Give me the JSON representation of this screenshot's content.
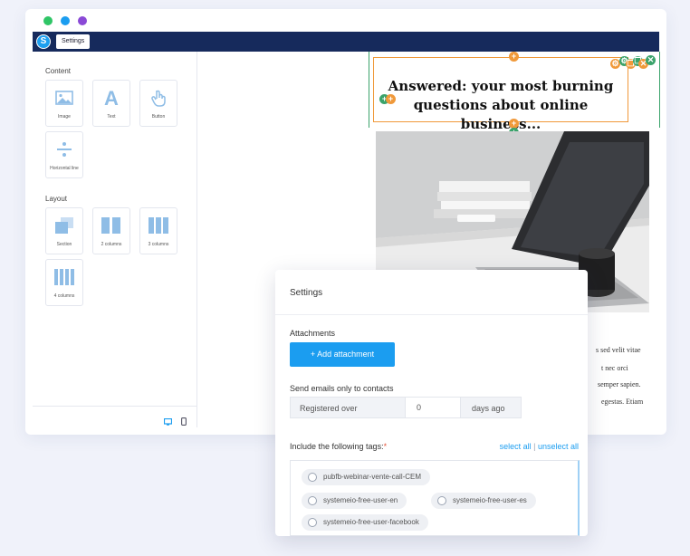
{
  "window": {
    "dot_colors": [
      "#2fc566",
      "#1b9df0",
      "#8a49d6"
    ]
  },
  "topbar": {
    "logo_letter": "S",
    "settings_label": "Settings"
  },
  "sidebar": {
    "content_title": "Content",
    "content_items": [
      {
        "label": "Image",
        "icon": "image-icon"
      },
      {
        "label": "Text",
        "icon": "text-icon"
      },
      {
        "label": "Button",
        "icon": "pointer-hand-icon"
      },
      {
        "label": "Horizontal line",
        "icon": "divider-icon"
      }
    ],
    "layout_title": "Layout",
    "layout_items": [
      {
        "label": "Section",
        "icon": "section-icon"
      },
      {
        "label": "2 columns",
        "icon": "two-columns-icon"
      },
      {
        "label": "3 columns",
        "icon": "three-columns-icon"
      },
      {
        "label": "4 columns",
        "icon": "four-columns-icon"
      }
    ],
    "footer_icons": [
      "desktop-icon",
      "mobile-icon"
    ]
  },
  "canvas": {
    "headline": "Answered: your most burning questions about online business...",
    "body_lines": [
      "s sed velit vitae",
      "t nec orci",
      "semper sapien.",
      "egestas. Etiam"
    ],
    "accent_orange": "#f0993a",
    "accent_green": "#3aa36b"
  },
  "panel": {
    "title": "Settings",
    "attachments_label": "Attachments",
    "add_attachment_label": "+ Add attachment",
    "send_only_label": "Send emails only to contacts",
    "registered_label": "Registered over",
    "registered_value": "0",
    "days_suffix": "days ago",
    "include_tags_label": "Include the following tags:",
    "required_mark": "*",
    "select_all": "select all",
    "separator": "|",
    "unselect_all": "unselect all",
    "tags": [
      "pubfb-webinar-vente-call-CEM",
      "systemeio-free-user-en",
      "systemeio-free-user-es",
      "systemeio-free-user-facebook"
    ],
    "accent_blue": "#1b9df0"
  }
}
